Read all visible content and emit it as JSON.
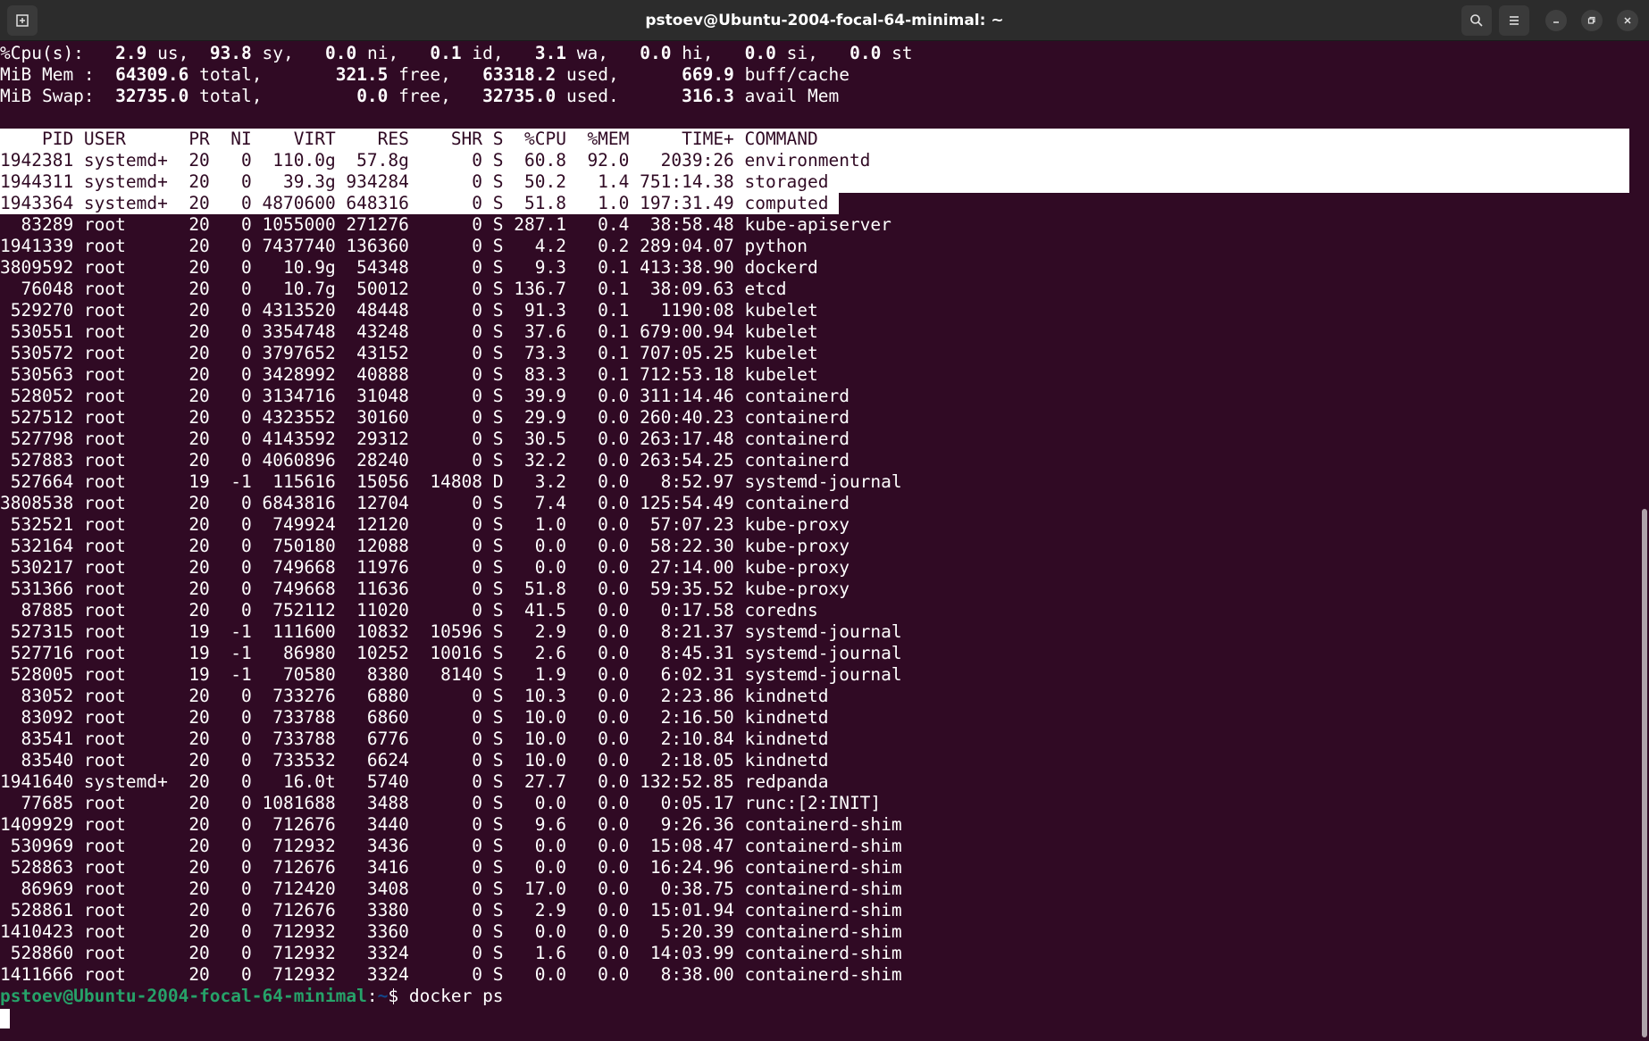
{
  "window": {
    "title": "pstoev@Ubuntu-2004-focal-64-minimal: ~"
  },
  "icons": {
    "new_tab": "new-tab-icon",
    "search": "search-icon",
    "menu": "hamburger-menu-icon",
    "minimize": "minimize-icon",
    "maximize": "maximize-icon",
    "close": "close-icon"
  },
  "summary": {
    "cpu": {
      "label": "%Cpu(s):",
      "fields": [
        {
          "value": "2.9",
          "unit": "us,"
        },
        {
          "value": "93.8",
          "unit": "sy,"
        },
        {
          "value": "0.0",
          "unit": "ni,"
        },
        {
          "value": "0.1",
          "unit": "id,"
        },
        {
          "value": "3.1",
          "unit": "wa,"
        },
        {
          "value": "0.0",
          "unit": "hi,"
        },
        {
          "value": "0.0",
          "unit": "si,"
        },
        {
          "value": "0.0",
          "unit": "st"
        }
      ]
    },
    "mem": {
      "label": "MiB Mem :",
      "fields": [
        {
          "value": "64309.6",
          "unit": "total,"
        },
        {
          "value": "321.5",
          "unit": "free,"
        },
        {
          "value": "63318.2",
          "unit": "used,"
        },
        {
          "value": "669.9",
          "unit": "buff/cache"
        }
      ]
    },
    "swap": {
      "label": "MiB Swap:",
      "fields": [
        {
          "value": "32735.0",
          "unit": "total,"
        },
        {
          "value": "0.0",
          "unit": "free,"
        },
        {
          "value": "32735.0",
          "unit": "used."
        },
        {
          "value": "316.3",
          "unit": "avail Mem"
        }
      ]
    }
  },
  "table": {
    "columns": [
      "PID",
      "USER",
      "PR",
      "NI",
      "VIRT",
      "RES",
      "SHR",
      "S",
      "%CPU",
      "%MEM",
      "TIME+",
      "COMMAND"
    ],
    "rows": [
      [
        "1942381",
        "systemd+",
        "20",
        "0",
        "110.0g",
        "57.8g",
        "0",
        "S",
        "60.8",
        "92.0",
        "2039:26",
        "environmentd"
      ],
      [
        "1944311",
        "systemd+",
        "20",
        "0",
        "39.3g",
        "934284",
        "0",
        "S",
        "50.2",
        "1.4",
        "751:14.38",
        "storaged"
      ],
      [
        "1943364",
        "systemd+",
        "20",
        "0",
        "4870600",
        "648316",
        "0",
        "S",
        "51.8",
        "1.0",
        "197:31.49",
        "computed"
      ],
      [
        "83289",
        "root",
        "20",
        "0",
        "1055000",
        "271276",
        "0",
        "S",
        "287.1",
        "0.4",
        "38:58.48",
        "kube-apiserver"
      ],
      [
        "1941339",
        "root",
        "20",
        "0",
        "7437740",
        "136360",
        "0",
        "S",
        "4.2",
        "0.2",
        "289:04.07",
        "python"
      ],
      [
        "3809592",
        "root",
        "20",
        "0",
        "10.9g",
        "54348",
        "0",
        "S",
        "9.3",
        "0.1",
        "413:38.90",
        "dockerd"
      ],
      [
        "76048",
        "root",
        "20",
        "0",
        "10.7g",
        "50012",
        "0",
        "S",
        "136.7",
        "0.1",
        "38:09.63",
        "etcd"
      ],
      [
        "529270",
        "root",
        "20",
        "0",
        "4313520",
        "48448",
        "0",
        "S",
        "91.3",
        "0.1",
        "1190:08",
        "kubelet"
      ],
      [
        "530551",
        "root",
        "20",
        "0",
        "3354748",
        "43248",
        "0",
        "S",
        "37.6",
        "0.1",
        "679:00.94",
        "kubelet"
      ],
      [
        "530572",
        "root",
        "20",
        "0",
        "3797652",
        "43152",
        "0",
        "S",
        "73.3",
        "0.1",
        "707:05.25",
        "kubelet"
      ],
      [
        "530563",
        "root",
        "20",
        "0",
        "3428992",
        "40888",
        "0",
        "S",
        "83.3",
        "0.1",
        "712:53.18",
        "kubelet"
      ],
      [
        "528052",
        "root",
        "20",
        "0",
        "3134716",
        "31048",
        "0",
        "S",
        "39.9",
        "0.0",
        "311:14.46",
        "containerd"
      ],
      [
        "527512",
        "root",
        "20",
        "0",
        "4323552",
        "30160",
        "0",
        "S",
        "29.9",
        "0.0",
        "260:40.23",
        "containerd"
      ],
      [
        "527798",
        "root",
        "20",
        "0",
        "4143592",
        "29312",
        "0",
        "S",
        "30.5",
        "0.0",
        "263:17.48",
        "containerd"
      ],
      [
        "527883",
        "root",
        "20",
        "0",
        "4060896",
        "28240",
        "0",
        "S",
        "32.2",
        "0.0",
        "263:54.25",
        "containerd"
      ],
      [
        "527664",
        "root",
        "19",
        "-1",
        "115616",
        "15056",
        "14808",
        "D",
        "3.2",
        "0.0",
        "8:52.97",
        "systemd-journal"
      ],
      [
        "3808538",
        "root",
        "20",
        "0",
        "6843816",
        "12704",
        "0",
        "S",
        "7.4",
        "0.0",
        "125:54.49",
        "containerd"
      ],
      [
        "532521",
        "root",
        "20",
        "0",
        "749924",
        "12120",
        "0",
        "S",
        "1.0",
        "0.0",
        "57:07.23",
        "kube-proxy"
      ],
      [
        "532164",
        "root",
        "20",
        "0",
        "750180",
        "12088",
        "0",
        "S",
        "0.0",
        "0.0",
        "58:22.30",
        "kube-proxy"
      ],
      [
        "530217",
        "root",
        "20",
        "0",
        "749668",
        "11976",
        "0",
        "S",
        "0.0",
        "0.0",
        "27:14.00",
        "kube-proxy"
      ],
      [
        "531366",
        "root",
        "20",
        "0",
        "749668",
        "11636",
        "0",
        "S",
        "51.8",
        "0.0",
        "59:35.52",
        "kube-proxy"
      ],
      [
        "87885",
        "root",
        "20",
        "0",
        "752112",
        "11020",
        "0",
        "S",
        "41.5",
        "0.0",
        "0:17.58",
        "coredns"
      ],
      [
        "527315",
        "root",
        "19",
        "-1",
        "111600",
        "10832",
        "10596",
        "S",
        "2.9",
        "0.0",
        "8:21.37",
        "systemd-journal"
      ],
      [
        "527716",
        "root",
        "19",
        "-1",
        "86980",
        "10252",
        "10016",
        "S",
        "2.6",
        "0.0",
        "8:45.31",
        "systemd-journal"
      ],
      [
        "528005",
        "root",
        "19",
        "-1",
        "70580",
        "8380",
        "8140",
        "S",
        "1.9",
        "0.0",
        "6:02.31",
        "systemd-journal"
      ],
      [
        "83052",
        "root",
        "20",
        "0",
        "733276",
        "6880",
        "0",
        "S",
        "10.3",
        "0.0",
        "2:23.86",
        "kindnetd"
      ],
      [
        "83092",
        "root",
        "20",
        "0",
        "733788",
        "6860",
        "0",
        "S",
        "10.0",
        "0.0",
        "2:16.50",
        "kindnetd"
      ],
      [
        "83541",
        "root",
        "20",
        "0",
        "733788",
        "6776",
        "0",
        "S",
        "10.0",
        "0.0",
        "2:10.84",
        "kindnetd"
      ],
      [
        "83540",
        "root",
        "20",
        "0",
        "733532",
        "6624",
        "0",
        "S",
        "10.0",
        "0.0",
        "2:18.05",
        "kindnetd"
      ],
      [
        "1941640",
        "systemd+",
        "20",
        "0",
        "16.0t",
        "5740",
        "0",
        "S",
        "27.7",
        "0.0",
        "132:52.85",
        "redpanda"
      ],
      [
        "77685",
        "root",
        "20",
        "0",
        "1081688",
        "3488",
        "0",
        "S",
        "0.0",
        "0.0",
        "0:05.17",
        "runc:[2:INIT]"
      ],
      [
        "1409929",
        "root",
        "20",
        "0",
        "712676",
        "3440",
        "0",
        "S",
        "9.6",
        "0.0",
        "9:26.36",
        "containerd-shim"
      ],
      [
        "530969",
        "root",
        "20",
        "0",
        "712932",
        "3436",
        "0",
        "S",
        "0.0",
        "0.0",
        "15:08.47",
        "containerd-shim"
      ],
      [
        "528863",
        "root",
        "20",
        "0",
        "712676",
        "3416",
        "0",
        "S",
        "0.0",
        "0.0",
        "16:24.96",
        "containerd-shim"
      ],
      [
        "86969",
        "root",
        "20",
        "0",
        "712420",
        "3408",
        "0",
        "S",
        "17.0",
        "0.0",
        "0:38.75",
        "containerd-shim"
      ],
      [
        "528861",
        "root",
        "20",
        "0",
        "712676",
        "3380",
        "0",
        "S",
        "2.9",
        "0.0",
        "15:01.94",
        "containerd-shim"
      ],
      [
        "1410423",
        "root",
        "20",
        "0",
        "712932",
        "3360",
        "0",
        "S",
        "0.0",
        "0.0",
        "5:20.39",
        "containerd-shim"
      ],
      [
        "528860",
        "root",
        "20",
        "0",
        "712932",
        "3324",
        "0",
        "S",
        "1.6",
        "0.0",
        "14:03.99",
        "containerd-shim"
      ],
      [
        "1411666",
        "root",
        "20",
        "0",
        "712932",
        "3324",
        "0",
        "S",
        "0.0",
        "0.0",
        "8:38.00",
        "containerd-shim"
      ]
    ]
  },
  "prompt": {
    "user_host": "pstoev@Ubuntu-2004-focal-64-minimal",
    "separator": ":",
    "path": "~",
    "symbol": "$ ",
    "command": "docker ps"
  }
}
